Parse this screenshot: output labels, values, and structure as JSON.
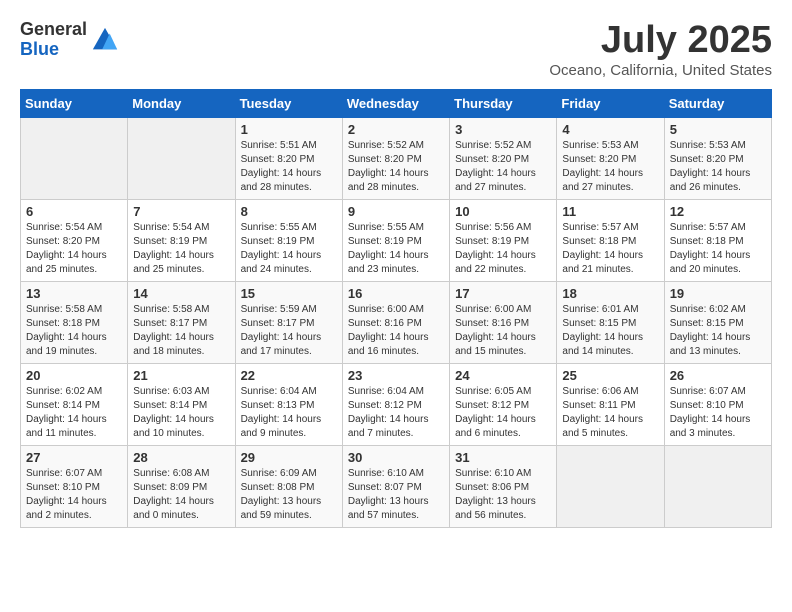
{
  "logo": {
    "general": "General",
    "blue": "Blue"
  },
  "title": {
    "month": "July 2025",
    "location": "Oceano, California, United States"
  },
  "weekdays": [
    "Sunday",
    "Monday",
    "Tuesday",
    "Wednesday",
    "Thursday",
    "Friday",
    "Saturday"
  ],
  "weeks": [
    [
      {
        "day": "",
        "info": ""
      },
      {
        "day": "",
        "info": ""
      },
      {
        "day": "1",
        "info": "Sunrise: 5:51 AM\nSunset: 8:20 PM\nDaylight: 14 hours and 28 minutes."
      },
      {
        "day": "2",
        "info": "Sunrise: 5:52 AM\nSunset: 8:20 PM\nDaylight: 14 hours and 28 minutes."
      },
      {
        "day": "3",
        "info": "Sunrise: 5:52 AM\nSunset: 8:20 PM\nDaylight: 14 hours and 27 minutes."
      },
      {
        "day": "4",
        "info": "Sunrise: 5:53 AM\nSunset: 8:20 PM\nDaylight: 14 hours and 27 minutes."
      },
      {
        "day": "5",
        "info": "Sunrise: 5:53 AM\nSunset: 8:20 PM\nDaylight: 14 hours and 26 minutes."
      }
    ],
    [
      {
        "day": "6",
        "info": "Sunrise: 5:54 AM\nSunset: 8:20 PM\nDaylight: 14 hours and 25 minutes."
      },
      {
        "day": "7",
        "info": "Sunrise: 5:54 AM\nSunset: 8:19 PM\nDaylight: 14 hours and 25 minutes."
      },
      {
        "day": "8",
        "info": "Sunrise: 5:55 AM\nSunset: 8:19 PM\nDaylight: 14 hours and 24 minutes."
      },
      {
        "day": "9",
        "info": "Sunrise: 5:55 AM\nSunset: 8:19 PM\nDaylight: 14 hours and 23 minutes."
      },
      {
        "day": "10",
        "info": "Sunrise: 5:56 AM\nSunset: 8:19 PM\nDaylight: 14 hours and 22 minutes."
      },
      {
        "day": "11",
        "info": "Sunrise: 5:57 AM\nSunset: 8:18 PM\nDaylight: 14 hours and 21 minutes."
      },
      {
        "day": "12",
        "info": "Sunrise: 5:57 AM\nSunset: 8:18 PM\nDaylight: 14 hours and 20 minutes."
      }
    ],
    [
      {
        "day": "13",
        "info": "Sunrise: 5:58 AM\nSunset: 8:18 PM\nDaylight: 14 hours and 19 minutes."
      },
      {
        "day": "14",
        "info": "Sunrise: 5:58 AM\nSunset: 8:17 PM\nDaylight: 14 hours and 18 minutes."
      },
      {
        "day": "15",
        "info": "Sunrise: 5:59 AM\nSunset: 8:17 PM\nDaylight: 14 hours and 17 minutes."
      },
      {
        "day": "16",
        "info": "Sunrise: 6:00 AM\nSunset: 8:16 PM\nDaylight: 14 hours and 16 minutes."
      },
      {
        "day": "17",
        "info": "Sunrise: 6:00 AM\nSunset: 8:16 PM\nDaylight: 14 hours and 15 minutes."
      },
      {
        "day": "18",
        "info": "Sunrise: 6:01 AM\nSunset: 8:15 PM\nDaylight: 14 hours and 14 minutes."
      },
      {
        "day": "19",
        "info": "Sunrise: 6:02 AM\nSunset: 8:15 PM\nDaylight: 14 hours and 13 minutes."
      }
    ],
    [
      {
        "day": "20",
        "info": "Sunrise: 6:02 AM\nSunset: 8:14 PM\nDaylight: 14 hours and 11 minutes."
      },
      {
        "day": "21",
        "info": "Sunrise: 6:03 AM\nSunset: 8:14 PM\nDaylight: 14 hours and 10 minutes."
      },
      {
        "day": "22",
        "info": "Sunrise: 6:04 AM\nSunset: 8:13 PM\nDaylight: 14 hours and 9 minutes."
      },
      {
        "day": "23",
        "info": "Sunrise: 6:04 AM\nSunset: 8:12 PM\nDaylight: 14 hours and 7 minutes."
      },
      {
        "day": "24",
        "info": "Sunrise: 6:05 AM\nSunset: 8:12 PM\nDaylight: 14 hours and 6 minutes."
      },
      {
        "day": "25",
        "info": "Sunrise: 6:06 AM\nSunset: 8:11 PM\nDaylight: 14 hours and 5 minutes."
      },
      {
        "day": "26",
        "info": "Sunrise: 6:07 AM\nSunset: 8:10 PM\nDaylight: 14 hours and 3 minutes."
      }
    ],
    [
      {
        "day": "27",
        "info": "Sunrise: 6:07 AM\nSunset: 8:10 PM\nDaylight: 14 hours and 2 minutes."
      },
      {
        "day": "28",
        "info": "Sunrise: 6:08 AM\nSunset: 8:09 PM\nDaylight: 14 hours and 0 minutes."
      },
      {
        "day": "29",
        "info": "Sunrise: 6:09 AM\nSunset: 8:08 PM\nDaylight: 13 hours and 59 minutes."
      },
      {
        "day": "30",
        "info": "Sunrise: 6:10 AM\nSunset: 8:07 PM\nDaylight: 13 hours and 57 minutes."
      },
      {
        "day": "31",
        "info": "Sunrise: 6:10 AM\nSunset: 8:06 PM\nDaylight: 13 hours and 56 minutes."
      },
      {
        "day": "",
        "info": ""
      },
      {
        "day": "",
        "info": ""
      }
    ]
  ]
}
